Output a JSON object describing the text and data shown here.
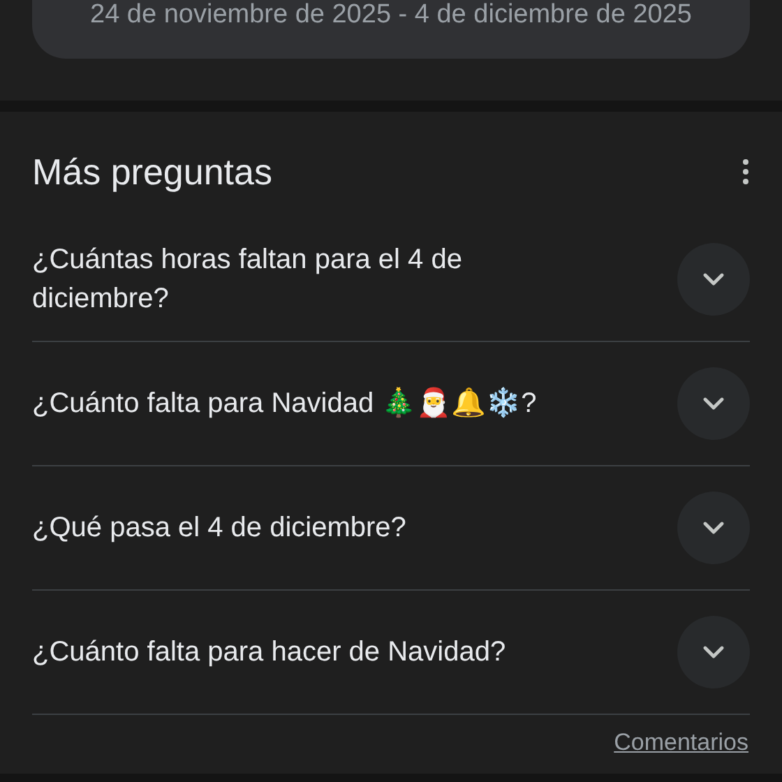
{
  "date_card": {
    "text": "24 de noviembre de 2025 - 4 de diciembre de 2025"
  },
  "more_questions": {
    "title": "Más preguntas",
    "questions": [
      {
        "text": "¿Cuántas horas faltan para el 4 de diciembre?",
        "expanded": false
      },
      {
        "text": "¿Cuánto falta para Navidad 🎄🎅🔔❄️?",
        "expanded": false
      },
      {
        "text": "¿Qué pasa el 4 de diciembre?",
        "expanded": false
      },
      {
        "text": "¿Cuánto falta para hacer de Navidad?",
        "expanded": false
      }
    ]
  },
  "footer": {
    "link": "Comentarios"
  }
}
